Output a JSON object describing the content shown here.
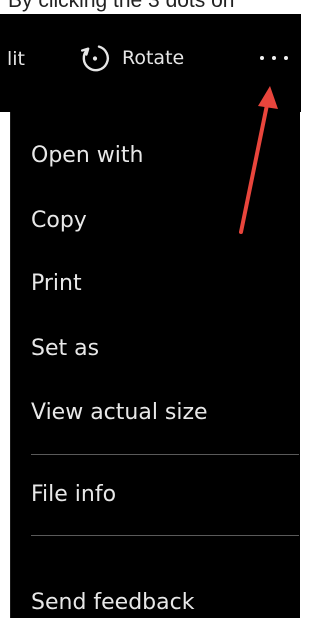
{
  "caption": "By clicking the 3 dots on",
  "toolbar": {
    "edit_label": "lit",
    "rotate_label": "Rotate",
    "more_icon": "more-horizontal-icon",
    "rotate_icon": "rotate-icon"
  },
  "menu": {
    "items": [
      {
        "label": "Open with"
      },
      {
        "label": "Copy"
      },
      {
        "label": "Print"
      },
      {
        "label": "Set as"
      },
      {
        "label": "View actual size"
      },
      {
        "label": "File info"
      },
      {
        "label": "Send feedback"
      }
    ]
  },
  "annotation": {
    "arrow_color": "#e8453c"
  },
  "colors": {
    "background": "#000000",
    "text": "#e8e8e8",
    "separator": "#5a5a5a"
  }
}
